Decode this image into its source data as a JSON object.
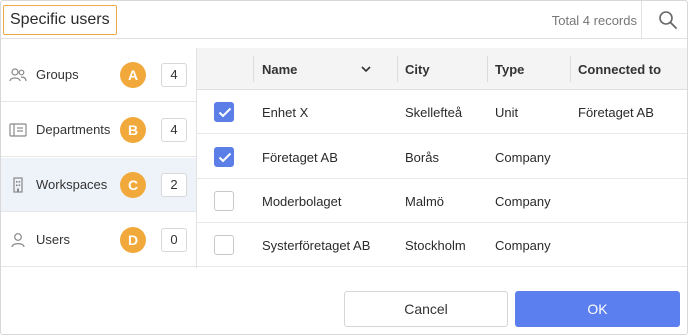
{
  "header": {
    "title": "Specific users",
    "total": "Total 4 records"
  },
  "sidebar": {
    "items": [
      {
        "label": "Groups",
        "letter": "A",
        "count": "4",
        "icon": "groups-icon",
        "active": false
      },
      {
        "label": "Departments",
        "letter": "B",
        "count": "4",
        "icon": "departments-icon",
        "active": false
      },
      {
        "label": "Workspaces",
        "letter": "C",
        "count": "2",
        "icon": "workspaces-icon",
        "active": true
      },
      {
        "label": "Users",
        "letter": "D",
        "count": "0",
        "icon": "user-icon",
        "active": false
      }
    ]
  },
  "table": {
    "columns": [
      "Name",
      "City",
      "Type",
      "Connected to"
    ],
    "rows": [
      {
        "checked": true,
        "name": "Enhet X",
        "city": "Skellefteå",
        "type": "Unit",
        "connected": "Företaget AB"
      },
      {
        "checked": true,
        "name": "Företaget AB",
        "city": "Borås",
        "type": "Company",
        "connected": ""
      },
      {
        "checked": false,
        "name": "Moderbolaget",
        "city": "Malmö",
        "type": "Company",
        "connected": ""
      },
      {
        "checked": false,
        "name": "Systerföretaget AB",
        "city": "Stockholm",
        "type": "Company",
        "connected": ""
      }
    ]
  },
  "footer": {
    "cancel_label": "Cancel",
    "ok_label": "OK"
  },
  "colors": {
    "accent": "#5b7fee",
    "badge": "#f2a93b",
    "active_row": "#eef3fa",
    "title_outline": "#f0a94a"
  }
}
